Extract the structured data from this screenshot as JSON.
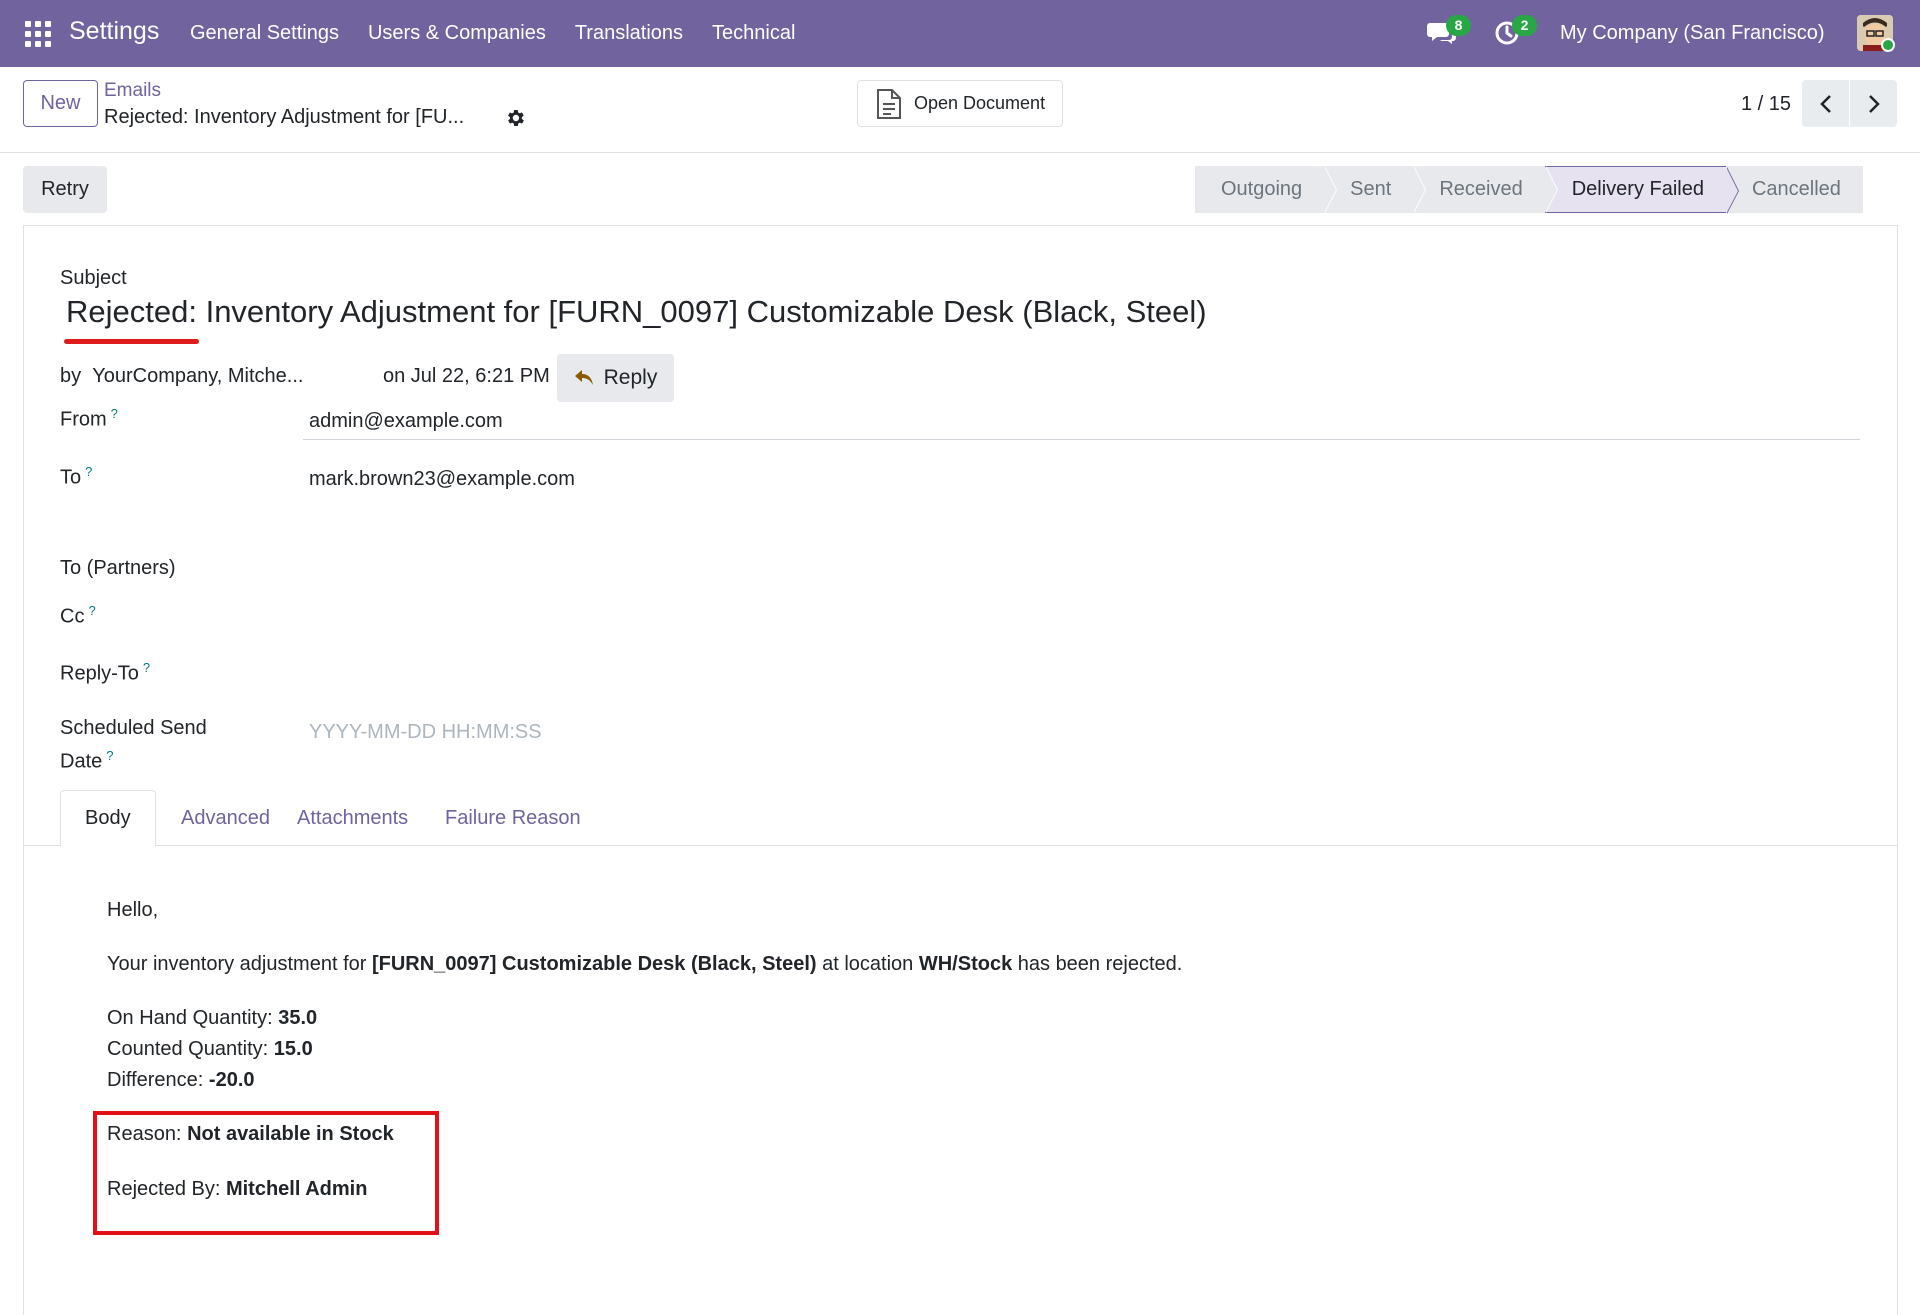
{
  "navbar": {
    "brand": "Settings",
    "menu": [
      "General Settings",
      "Users & Companies",
      "Translations",
      "Technical"
    ],
    "chat_count": "8",
    "activity_count": "2",
    "company": "My Company (San Francisco)",
    "color": "#71639e"
  },
  "control_panel": {
    "new_label": "New",
    "breadcrumb_parent": "Emails",
    "breadcrumb_current": "Rejected: Inventory Adjustment for [FU...",
    "open_document_label": "Open Document",
    "pager": "1 / 15"
  },
  "status": {
    "retry_label": "Retry",
    "stages": [
      "Outgoing",
      "Sent",
      "Received",
      "Delivery Failed",
      "Cancelled"
    ],
    "active_stage": "Delivery Failed"
  },
  "form": {
    "subject_label": "Subject",
    "subject": "Rejected: Inventory Adjustment for [FURN_0097] Customizable Desk (Black, Steel)",
    "by_prefix": "by",
    "author": "YourCompany, Mitche...",
    "date": "on Jul 22, 6:21 PM",
    "reply_label": "Reply",
    "from_label": "From",
    "from_value": "admin@example.com",
    "to_label": "To",
    "to_value": "mark.brown23@example.com",
    "to_partners_label": "To (Partners)",
    "cc_label": "Cc",
    "reply_to_label": "Reply-To",
    "scheduled_label_1": "Scheduled Send",
    "scheduled_label_2": "Date",
    "scheduled_placeholder": "YYYY-MM-DD HH:MM:SS",
    "help_mark": "?"
  },
  "tabs": [
    "Body",
    "Advanced",
    "Attachments",
    "Failure Reason"
  ],
  "body": {
    "greeting": "Hello,",
    "line_prefix": "Your inventory adjustment for ",
    "product": "[FURN_0097] Customizable Desk (Black, Steel)",
    "line_mid": " at location ",
    "location": "WH/Stock",
    "line_suffix": " has been rejected.",
    "on_hand_label": "On Hand Quantity: ",
    "on_hand_value": "35.0",
    "counted_label": "Counted Quantity: ",
    "counted_value": "15.0",
    "difference_label": "Difference: ",
    "difference_value": "-20.0",
    "reason_label": "Reason: ",
    "reason_value": "Not available in Stock",
    "rejected_by_label": "Rejected By: ",
    "rejected_by_value": "Mitchell Admin"
  }
}
